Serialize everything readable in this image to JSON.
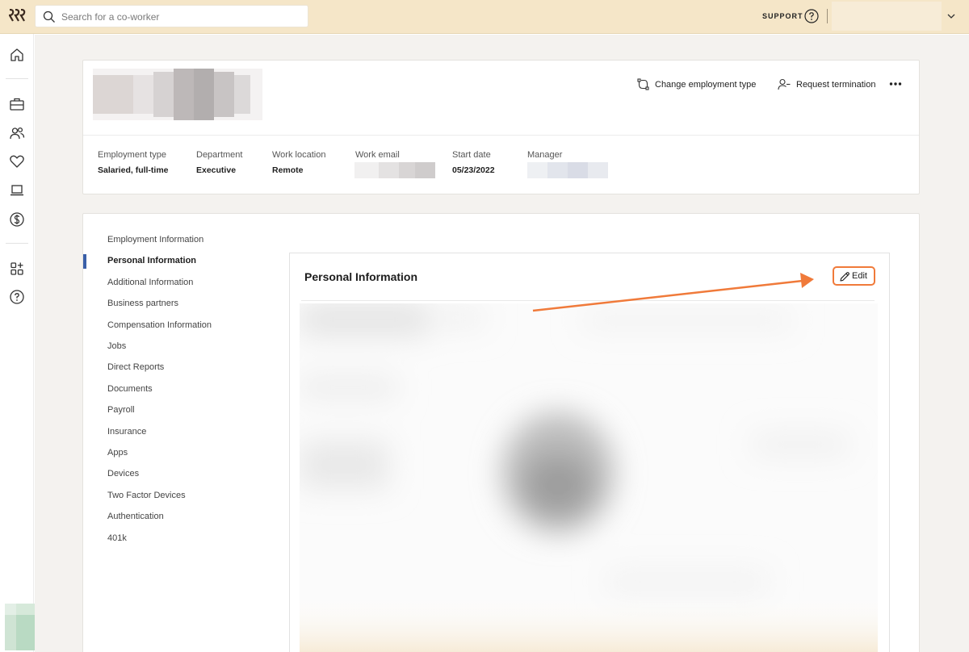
{
  "topbar": {
    "logo_icon": "rippling-logo-icon",
    "search_placeholder": "Search for a co-worker",
    "support_label": "SUPPORT",
    "colors": {
      "background": "#f5e6c8"
    }
  },
  "leftnav": {
    "icons": [
      "home-icon",
      "briefcase-icon",
      "people-icon",
      "heart-icon",
      "laptop-icon",
      "dollar-icon",
      "apps-add-icon",
      "help-icon"
    ]
  },
  "header": {
    "actions": {
      "change_employment_type": "Change employment type",
      "request_termination": "Request termination"
    },
    "fields": [
      {
        "label": "Employment type",
        "value": "Salaried, full-time"
      },
      {
        "label": "Department",
        "value": "Executive"
      },
      {
        "label": "Work location",
        "value": "Remote"
      },
      {
        "label": "Work email",
        "value": ""
      },
      {
        "label": "Start date",
        "value": "05/23/2022"
      },
      {
        "label": "Manager",
        "value": ""
      }
    ]
  },
  "subnav": {
    "items": [
      "Employment Information",
      "Personal Information",
      "Additional Information",
      "Business partners",
      "Compensation Information",
      "Jobs",
      "Direct Reports",
      "Documents",
      "Payroll",
      "Insurance",
      "Apps",
      "Devices",
      "Two Factor Devices",
      "Authentication",
      "401k"
    ],
    "active": "Personal Information",
    "accent_color": "#3a5fa8"
  },
  "panel": {
    "title": "Personal Information",
    "edit_label": "Edit",
    "highlight_color": "#f07a3a"
  }
}
